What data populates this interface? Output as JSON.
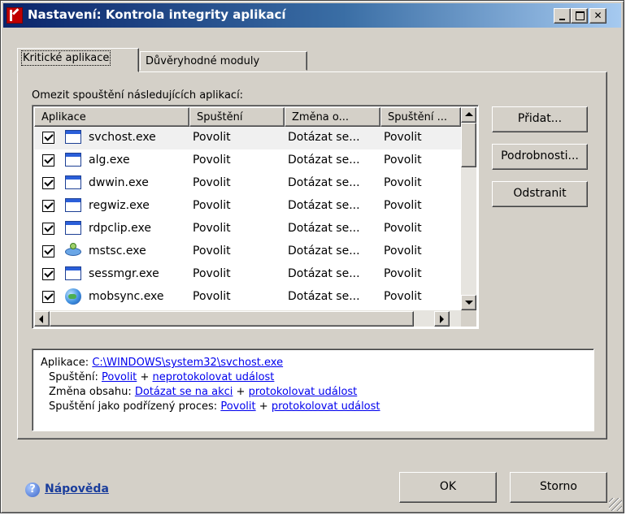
{
  "window": {
    "title": "Nastavení: Kontrola integrity aplikací"
  },
  "tabs": [
    {
      "label": "Kritické aplikace",
      "active": true
    },
    {
      "label": "Důvěryhodné moduly",
      "active": false
    }
  ],
  "list": {
    "label": "Omezit spouštění následujících aplikací:",
    "columns": [
      "Aplikace",
      "Spuštění",
      "Změna o...",
      "Spuštění ..."
    ],
    "rows": [
      {
        "name": "svchost.exe",
        "run": "Povolit",
        "change": "Dotázat se...",
        "child": "Povolit",
        "checked": true,
        "icon": "window-icon"
      },
      {
        "name": "alg.exe",
        "run": "Povolit",
        "change": "Dotázat se...",
        "child": "Povolit",
        "checked": true,
        "icon": "window-icon"
      },
      {
        "name": "dwwin.exe",
        "run": "Povolit",
        "change": "Dotázat se...",
        "child": "Povolit",
        "checked": true,
        "icon": "window-icon"
      },
      {
        "name": "regwiz.exe",
        "run": "Povolit",
        "change": "Dotázat se...",
        "child": "Povolit",
        "checked": true,
        "icon": "window-icon"
      },
      {
        "name": "rdpclip.exe",
        "run": "Povolit",
        "change": "Dotázat se...",
        "child": "Povolit",
        "checked": true,
        "icon": "window-icon"
      },
      {
        "name": "mstsc.exe",
        "run": "Povolit",
        "change": "Dotázat se...",
        "child": "Povolit",
        "checked": true,
        "icon": "network-icon"
      },
      {
        "name": "sessmgr.exe",
        "run": "Povolit",
        "change": "Dotázat se...",
        "child": "Povolit",
        "checked": true,
        "icon": "window-icon"
      },
      {
        "name": "mobsync.exe",
        "run": "Povolit",
        "change": "Dotázat se...",
        "child": "Povolit",
        "checked": true,
        "icon": "globe-icon"
      }
    ]
  },
  "buttons": {
    "add": "Přidat...",
    "details": "Podrobnosti...",
    "remove": "Odstranit",
    "ok": "OK",
    "cancel": "Storno"
  },
  "details_box": {
    "app_label": "Aplikace:",
    "app_path": "C:\\WINDOWS\\system32\\svchost.exe",
    "run_label": "Spuštění:",
    "run_value": "Povolit",
    "run_log": "neprotokolovat událost",
    "change_label": "Změna obsahu:",
    "change_value": "Dotázat se na akci",
    "change_log": "protokolovat událost",
    "child_label": "Spuštění jako podřízený proces:",
    "child_value": "Povolit",
    "child_log": "protokolovat událost",
    "plus": "+"
  },
  "help": {
    "label": "Nápověda"
  }
}
